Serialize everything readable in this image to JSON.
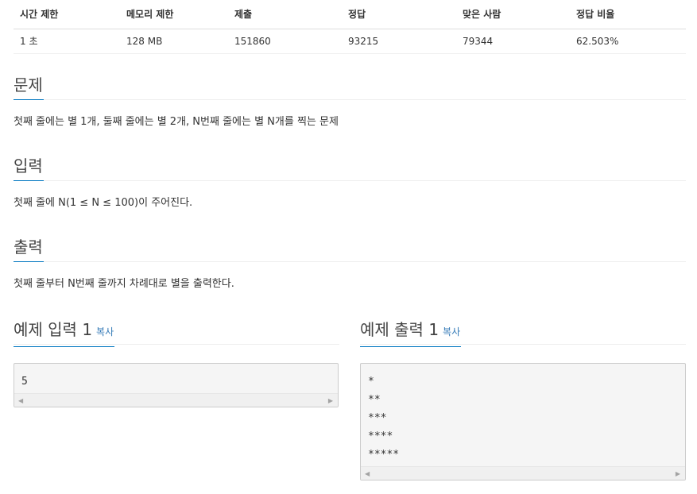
{
  "info": {
    "headers": [
      "시간 제한",
      "메모리 제한",
      "제출",
      "정답",
      "맞은 사람",
      "정답 비율"
    ],
    "values": [
      "1 초",
      "128 MB",
      "151860",
      "93215",
      "79344",
      "62.503%"
    ]
  },
  "sections": {
    "problem": {
      "title": "문제",
      "text": "첫째 줄에는 별 1개, 둘째 줄에는 별 2개, N번째 줄에는 별 N개를 찍는 문제"
    },
    "input": {
      "title": "입력",
      "text": "첫째 줄에 N(1 ≤ N ≤ 100)이 주어진다."
    },
    "output": {
      "title": "출력",
      "text": "첫째 줄부터 N번째 줄까지 차례대로 별을 출력한다."
    }
  },
  "samples": {
    "input": {
      "title": "예제 입력 1",
      "copy_label": "복사",
      "content": "5"
    },
    "output": {
      "title": "예제 출력 1",
      "copy_label": "복사",
      "content": "*\n**\n***\n****\n*****"
    }
  },
  "icons": {
    "scroll_left": "scroll-left-arrow-icon",
    "scroll_right": "scroll-right-arrow-icon"
  },
  "colors": {
    "accent": "#0076c0",
    "link": "#337ab7",
    "code_bg": "#f5f5f5"
  }
}
